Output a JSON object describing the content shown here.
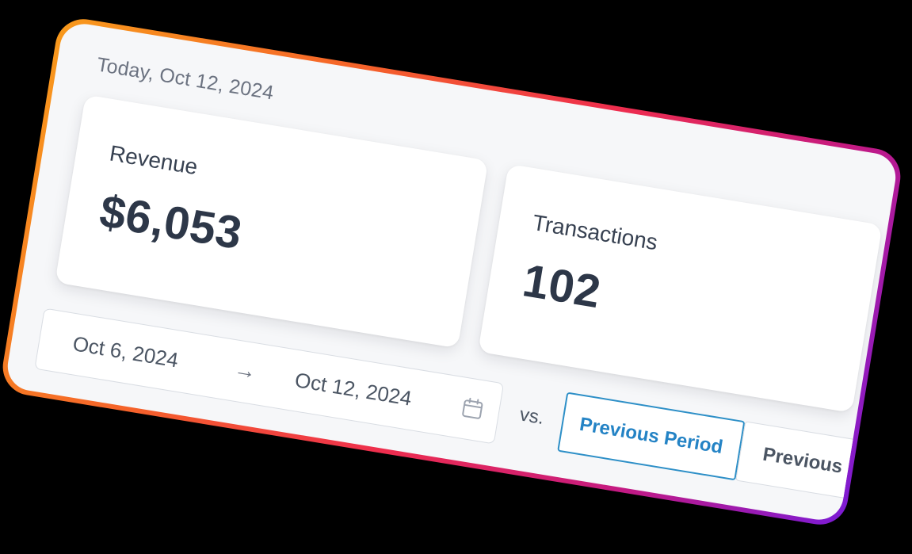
{
  "header": {
    "date_label": "Today, Oct 12, 2024"
  },
  "metrics": {
    "revenue": {
      "label": "Revenue",
      "value": "$6,053"
    },
    "transactions": {
      "label": "Transactions",
      "value": "102"
    }
  },
  "date_range": {
    "start": "Oct 6, 2024",
    "arrow": "→",
    "end": "Oct 12, 2024",
    "icon": "calendar-icon"
  },
  "comparison": {
    "vs_label": "vs.",
    "options": [
      {
        "label": "Previous Period",
        "selected": true
      },
      {
        "label": "Previous",
        "selected": false
      }
    ]
  },
  "colors": {
    "accent": "#2483c5",
    "frame_gradient": [
      "#f89a1c",
      "#f5622a",
      "#ee2d4e",
      "#c41a82",
      "#7b1bd6"
    ],
    "panel_background": "#f6f7f9"
  }
}
